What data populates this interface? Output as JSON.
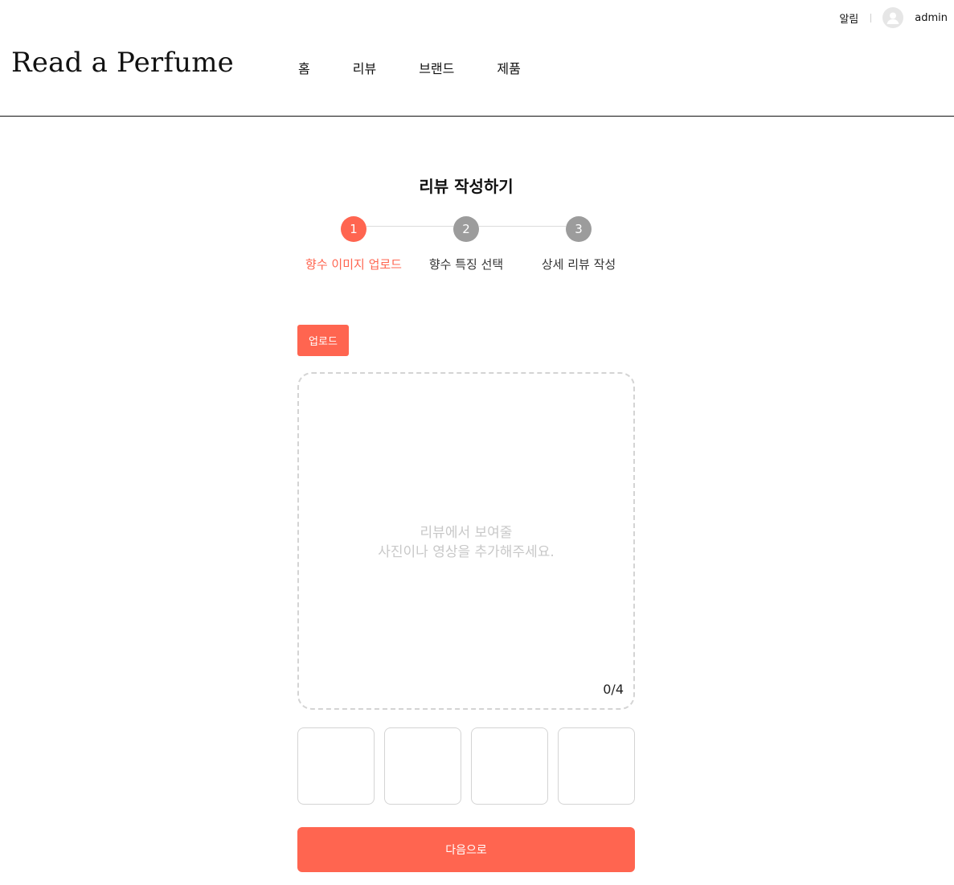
{
  "header": {
    "alarm_label": "알림",
    "username": "admin",
    "logo": "Read a Perfume",
    "nav": [
      "홈",
      "리뷰",
      "브랜드",
      "제품"
    ],
    "avatar_icon": "user-avatar-icon"
  },
  "page": {
    "title": "리뷰 작성하기"
  },
  "stepper": {
    "steps": [
      {
        "number": "1",
        "label": "향수 이미지 업로드",
        "active": true
      },
      {
        "number": "2",
        "label": "향수 특징 선택",
        "active": false
      },
      {
        "number": "3",
        "label": "상세 리뷰 작성",
        "active": false
      }
    ]
  },
  "upload": {
    "button_label": "업로드",
    "placeholder_line1": "리뷰에서 보여줄",
    "placeholder_line2": "사진이나 영상을 추가해주세요.",
    "counter": "0/4",
    "thumbnail_count": 4
  },
  "actions": {
    "next_label": "다음으로"
  },
  "colors": {
    "accent": "#ff6550",
    "step_idle": "#9c9c9c",
    "border": "#d4d4d4"
  }
}
